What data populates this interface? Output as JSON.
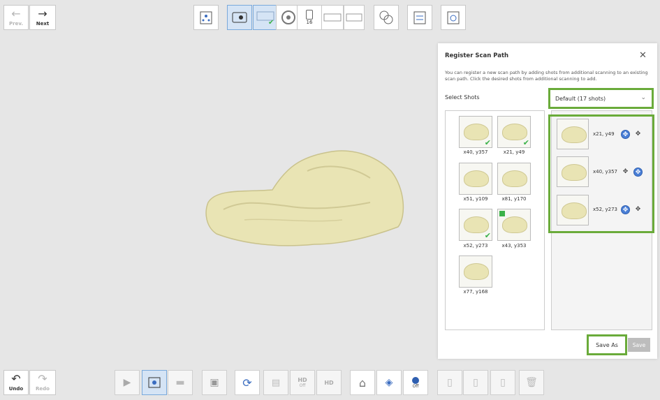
{
  "nav": {
    "prev_label": "Prev.",
    "next_label": "Next",
    "undo_label": "Undo",
    "redo_label": "Redo"
  },
  "toolbar": {
    "step_count": "16"
  },
  "bottom_toolbar": {
    "hd_label": "HD",
    "off_label": "Off"
  },
  "dialog": {
    "title": "Register Scan Path",
    "description": "You can register a new scan path by adding shots from additional scanning to an existing scan path. Click the desired shots from additional scanning to add.",
    "select_label": "Select Shots",
    "dropdown_value": "Default (17 shots)",
    "left_shots": [
      {
        "label": "x40, y357",
        "checked": true
      },
      {
        "label": "x21, y49",
        "checked": true
      },
      {
        "label": "x51, y109",
        "checked": false
      },
      {
        "label": "x81, y170",
        "checked": false
      },
      {
        "label": "x52, y273",
        "checked": true
      },
      {
        "label": "x43, y353",
        "checked": false
      },
      {
        "label": "x77, y168",
        "checked": false
      }
    ],
    "right_shots": [
      {
        "label": "x21, y49"
      },
      {
        "label": "x40, y357"
      },
      {
        "label": "x52, y273"
      }
    ],
    "save_as_label": "Save As",
    "save_label": "Save"
  },
  "colors": {
    "highlight": "#6aab3a",
    "model": "#e9e4b4",
    "check": "#3bb24a",
    "accent": "#4a7fd6"
  }
}
